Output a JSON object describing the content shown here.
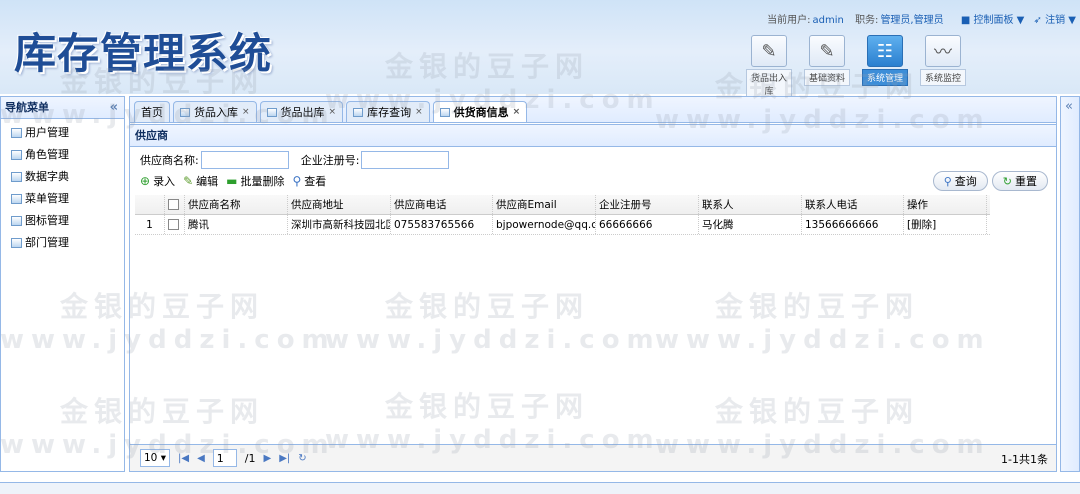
{
  "header": {
    "logo": "库存管理系统",
    "current_user_label": "当前用户:",
    "current_user": "admin",
    "role_label": "职务:",
    "roles": "管理员,管理员",
    "control_panel": "控制面板",
    "logout": "注销",
    "tools": [
      {
        "label": "货品出入库",
        "icon": "edit-icon"
      },
      {
        "label": "基础资料",
        "icon": "edit-icon"
      },
      {
        "label": "系统管理",
        "icon": "settings-icon"
      },
      {
        "label": "系统监控",
        "icon": "monitor-icon"
      }
    ]
  },
  "watermark": {
    "cn": "金银的豆子网",
    "en": "www.jyddzi.com"
  },
  "sidebar": {
    "title": "导航菜单",
    "collapse": "«",
    "items": [
      {
        "label": "用户管理"
      },
      {
        "label": "角色管理"
      },
      {
        "label": "数据字典"
      },
      {
        "label": "菜单管理"
      },
      {
        "label": "图标管理"
      },
      {
        "label": "部门管理"
      }
    ]
  },
  "tabs": [
    {
      "label": "首页",
      "closable": false
    },
    {
      "label": "货品入库",
      "closable": true
    },
    {
      "label": "货品出库",
      "closable": true
    },
    {
      "label": "库存查询",
      "closable": true
    },
    {
      "label": "供货商信息",
      "closable": true,
      "selected": true
    }
  ],
  "tab_close": "×",
  "panel": {
    "title": "供应商",
    "search": {
      "name_label": "供应商名称:",
      "reg_label": "企业注册号:",
      "name_value": "",
      "reg_value": ""
    },
    "toolbar": {
      "add": "录入",
      "edit": "编辑",
      "batch_delete": "批量删除",
      "view": "查看",
      "query": "查询",
      "reset": "重置"
    }
  },
  "grid": {
    "columns": [
      "供应商名称",
      "供应商地址",
      "供应商电话",
      "供应商Email",
      "企业注册号",
      "联系人",
      "联系人电话",
      "操作"
    ],
    "rows": [
      {
        "num": "1",
        "cells": [
          "腾讯",
          "深圳市高新科技园北区",
          "075583765566",
          "bjpowernode@qq.com",
          "66666666",
          "马化腾",
          "13566666666",
          "[删除]"
        ]
      }
    ]
  },
  "pager": {
    "page_size": "10",
    "page": "1",
    "total_pages": "/1",
    "info": "1-1共1条"
  },
  "rightbar": {
    "collapse": "«"
  },
  "colors": {
    "border": "#95b8e7",
    "brand": "#1f4d96",
    "active_tool": "#3d8ed8"
  }
}
